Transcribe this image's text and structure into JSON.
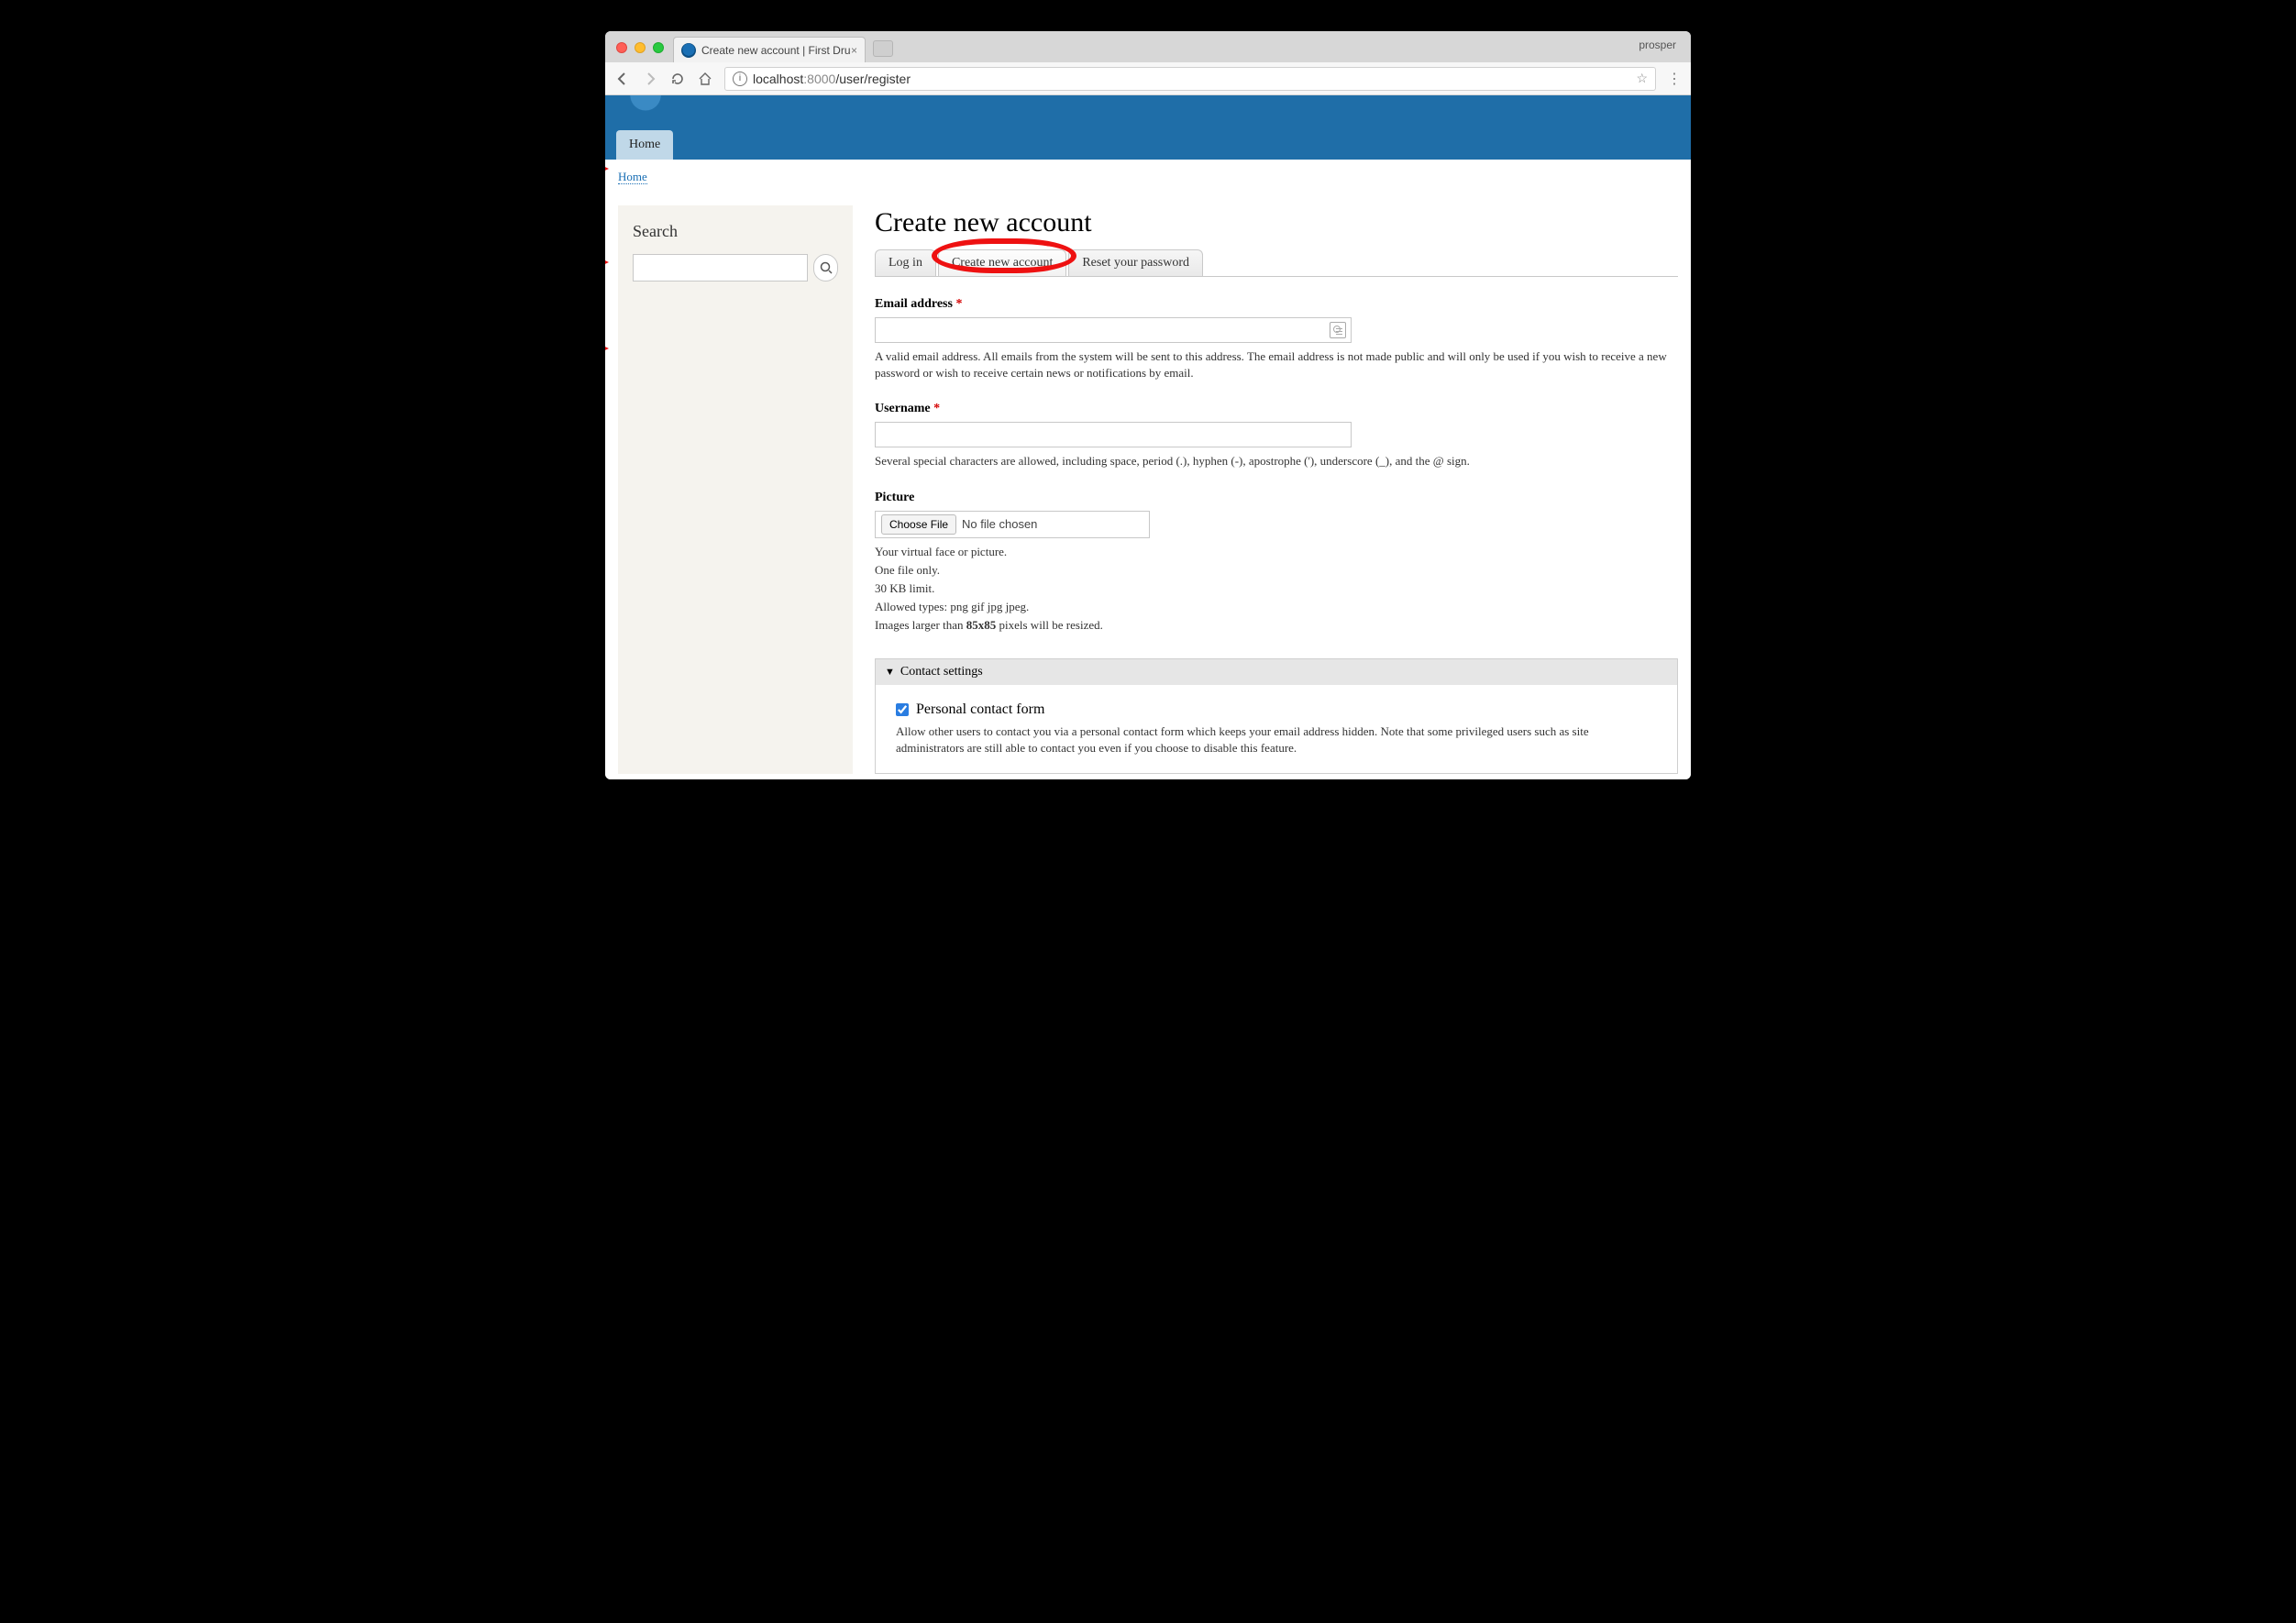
{
  "browser": {
    "profile": "prosper",
    "tab_title": "Create new account | First Dru",
    "url_host": "localhost",
    "url_port": ":8000",
    "url_path": "/user/register"
  },
  "nav": {
    "home": "Home"
  },
  "breadcrumb": {
    "home": "Home"
  },
  "sidebar": {
    "search_heading": "Search"
  },
  "page": {
    "title": "Create new account",
    "tabs": {
      "login": "Log in",
      "create": "Create new account",
      "reset": "Reset your password"
    }
  },
  "form": {
    "email": {
      "label": "Email address",
      "help": "A valid email address. All emails from the system will be sent to this address. The email address is not made public and will only be used if you wish to receive a new password or wish to receive certain news or notifications by email."
    },
    "username": {
      "label": "Username",
      "help": "Several special characters are allowed, including space, period (.), hyphen (-), apostrophe ('), underscore (_), and the @ sign."
    },
    "picture": {
      "label": "Picture",
      "choose": "Choose File",
      "nofile": "No file chosen",
      "help1": "Your virtual face or picture.",
      "help2": "One file only.",
      "help3": "30 KB limit.",
      "help4": "Allowed types: png gif jpg jpeg.",
      "help5a": "Images larger than ",
      "help5b": "85x85",
      "help5c": " pixels will be resized."
    },
    "contact": {
      "summary": "Contact settings",
      "checkbox_label": "Personal contact form",
      "help": "Allow other users to contact you via a personal contact form which keeps your email address hidden. Note that some privileged users such as site administrators are still able to contact you even if you choose to disable this feature."
    }
  }
}
